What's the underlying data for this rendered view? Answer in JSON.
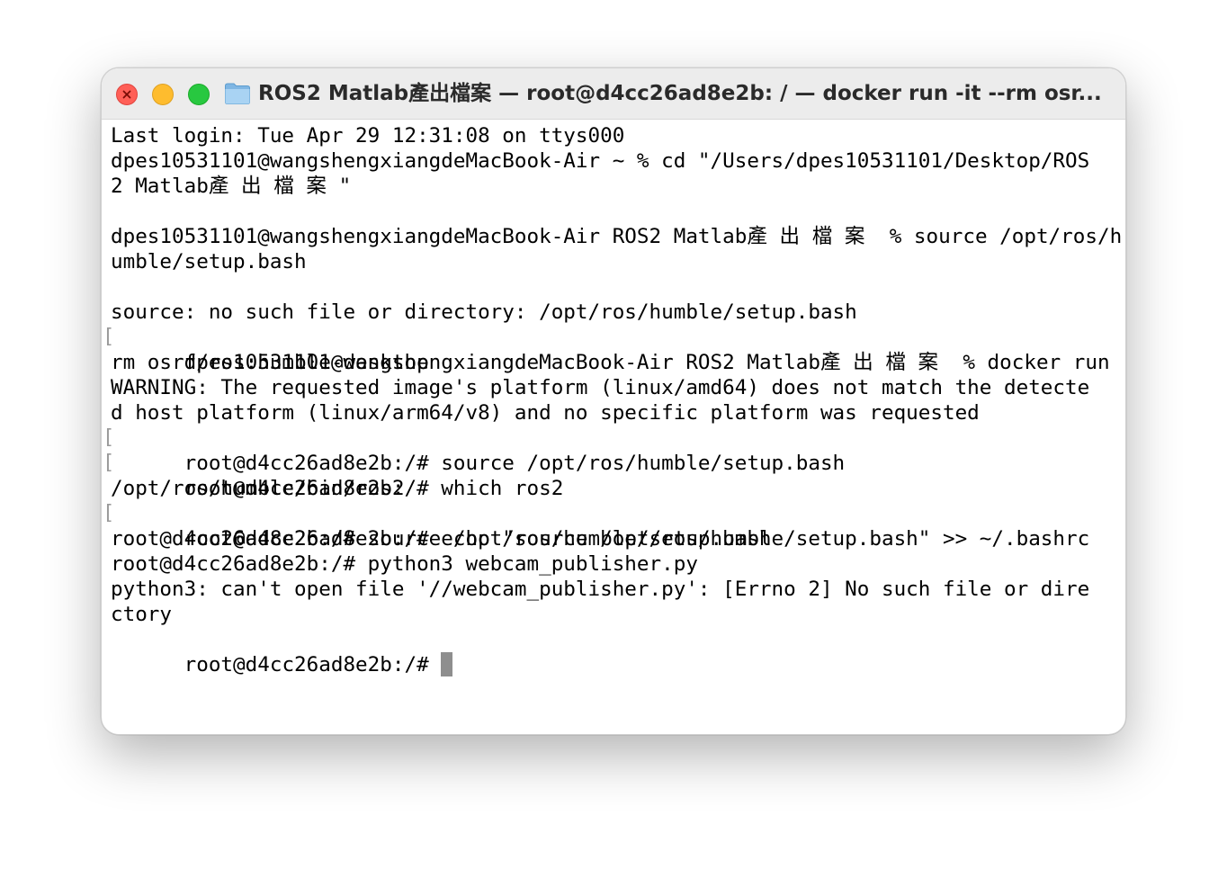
{
  "window": {
    "title": "ROS2 Matlab產出檔案 — root@d4cc26ad8e2b: / — docker run -it --rm osr..."
  },
  "icons": {
    "close": "close-icon",
    "minimize": "minimize-icon",
    "zoom": "zoom-icon",
    "folder": "folder-icon"
  },
  "colors": {
    "close": "#ff5f57",
    "minimize": "#febc2e",
    "zoom": "#28c840",
    "folder": "#8fc3ea"
  },
  "terminal": {
    "lines": [
      "Last login: Tue Apr 29 12:31:08 on ttys000",
      "dpes10531101@wangshengxiangdeMacBook-Air ~ % cd \"/Users/dpes10531101/Desktop/ROS",
      "2 Matlab產 出 檔 案 \"",
      "",
      "dpes10531101@wangshengxiangdeMacBook-Air ROS2 Matlab產 出 檔 案  % source /opt/ros/h",
      "umble/setup.bash",
      "",
      "source: no such file or directory: /opt/ros/humble/setup.bash",
      "dpes10531101@wangshengxiangdeMacBook-Air ROS2 Matlab產 出 檔 案  % docker run -it --",
      "rm osrf/ros:humble-desktop",
      "WARNING: The requested image's platform (linux/amd64) does not match the detecte",
      "d host platform (linux/arm64/v8) and no specific platform was requested",
      "root@d4cc26ad8e2b:/# source /opt/ros/humble/setup.bash",
      "root@d4cc26ad8e2b:/# which ros2",
      "/opt/ros/humble/bin/ros2",
      "root@d4cc26ad8e2b:/# echo \"source /opt/ros/humble/setup.bash\" >> ~/.bashrc",
      "root@d4cc26ad8e2b:/# source /opt/ros/humble/setup.bash",
      "root@d4cc26ad8e2b:/# python3 webcam_publisher.py",
      "python3: can't open file '//webcam_publisher.py': [Errno 2] No such file or dire",
      "ctory"
    ],
    "prompt": "root@d4cc26ad8e2b:/# ",
    "bracket_left": "[",
    "bracket_right": "]"
  }
}
